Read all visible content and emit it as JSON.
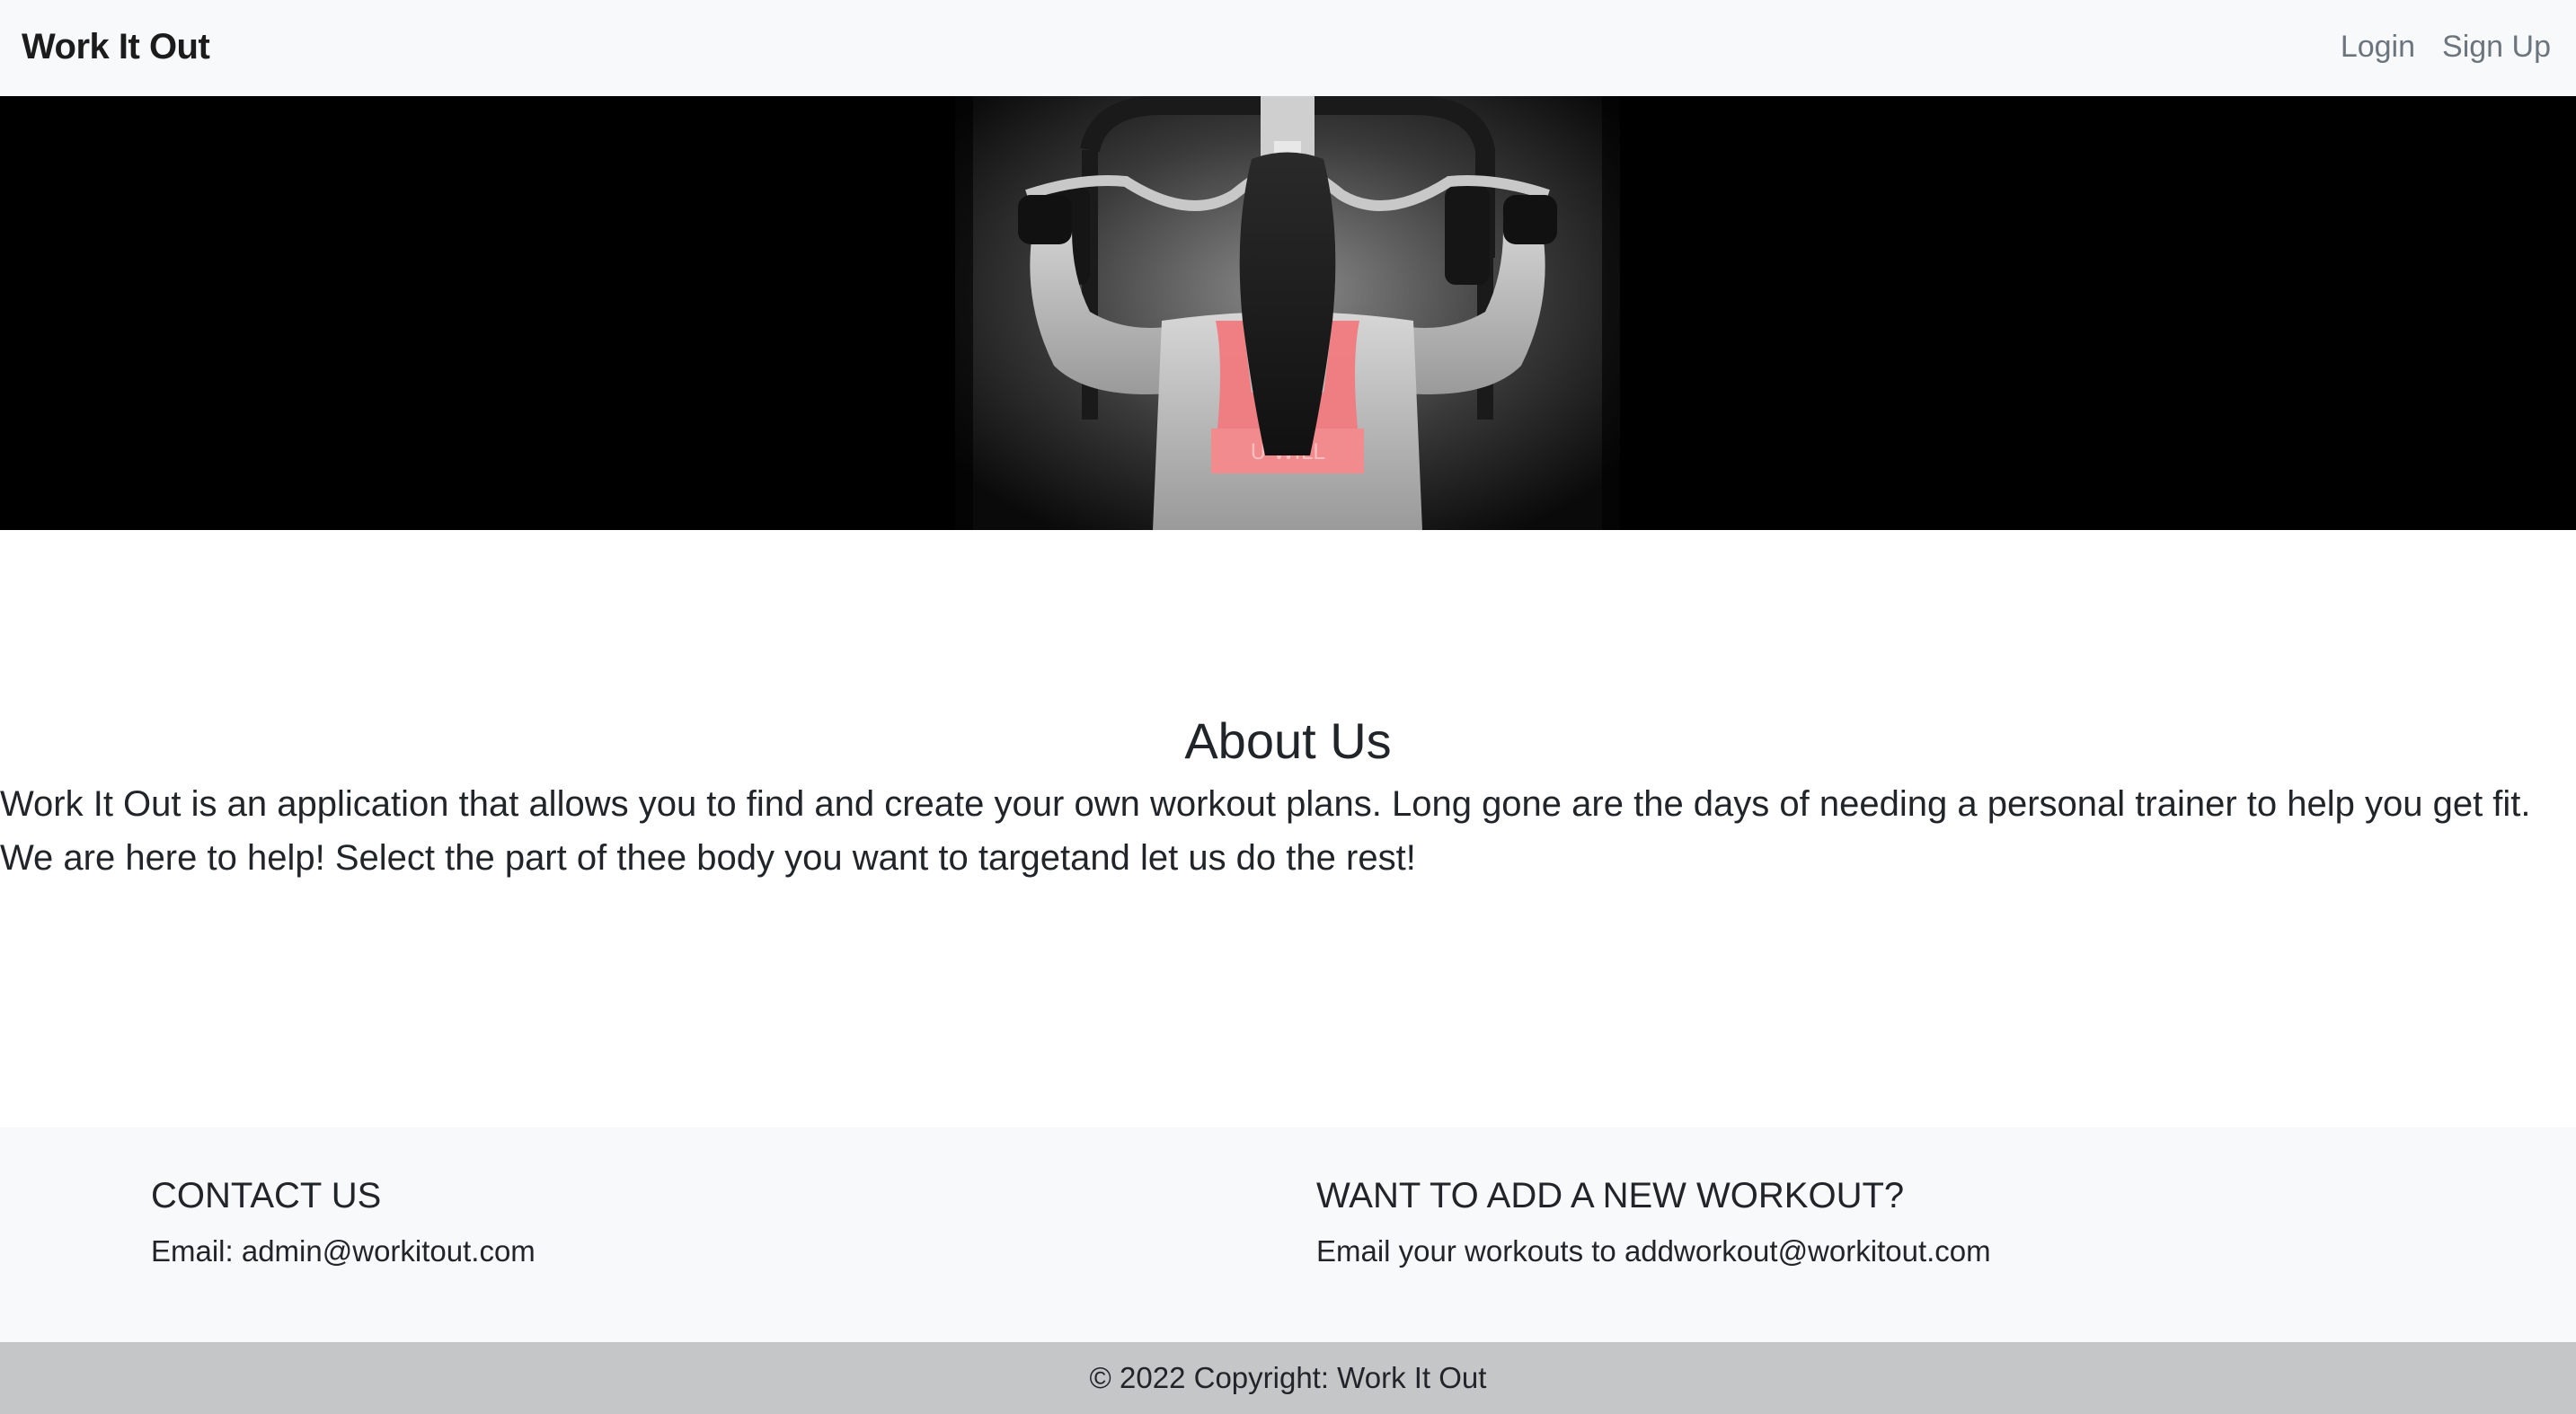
{
  "navbar": {
    "brand": "Work It Out",
    "links": [
      {
        "label": "Login"
      },
      {
        "label": "Sign Up"
      }
    ]
  },
  "hero": {
    "image_alt": "Woman doing lat pulldown exercise",
    "shirt_text": "UNDER ARMOUR WILL",
    "colors": {
      "background": "#000000",
      "accent": "#f0777a"
    }
  },
  "about": {
    "title": "About Us",
    "text": "Work It Out is an application that allows you to find and create your own workout plans. Long gone are the days of needing a personal trainer to help you get fit. We are here to help! Select the part of thee body you want to targetand let us do the rest!"
  },
  "footer": {
    "contact": {
      "heading": "CONTACT US",
      "text": "Email: admin@workitout.com"
    },
    "add_workout": {
      "heading": "WANT TO ADD A NEW WORKOUT?",
      "text": "Email your workouts to addworkout@workitout.com"
    },
    "copyright": "© 2022 Copyright: Work It Out"
  },
  "colors": {
    "navbar_bg": "#f8f9fa",
    "copyright_bg": "#c5c6c8",
    "text": "#212529",
    "muted": "#6c757d"
  }
}
